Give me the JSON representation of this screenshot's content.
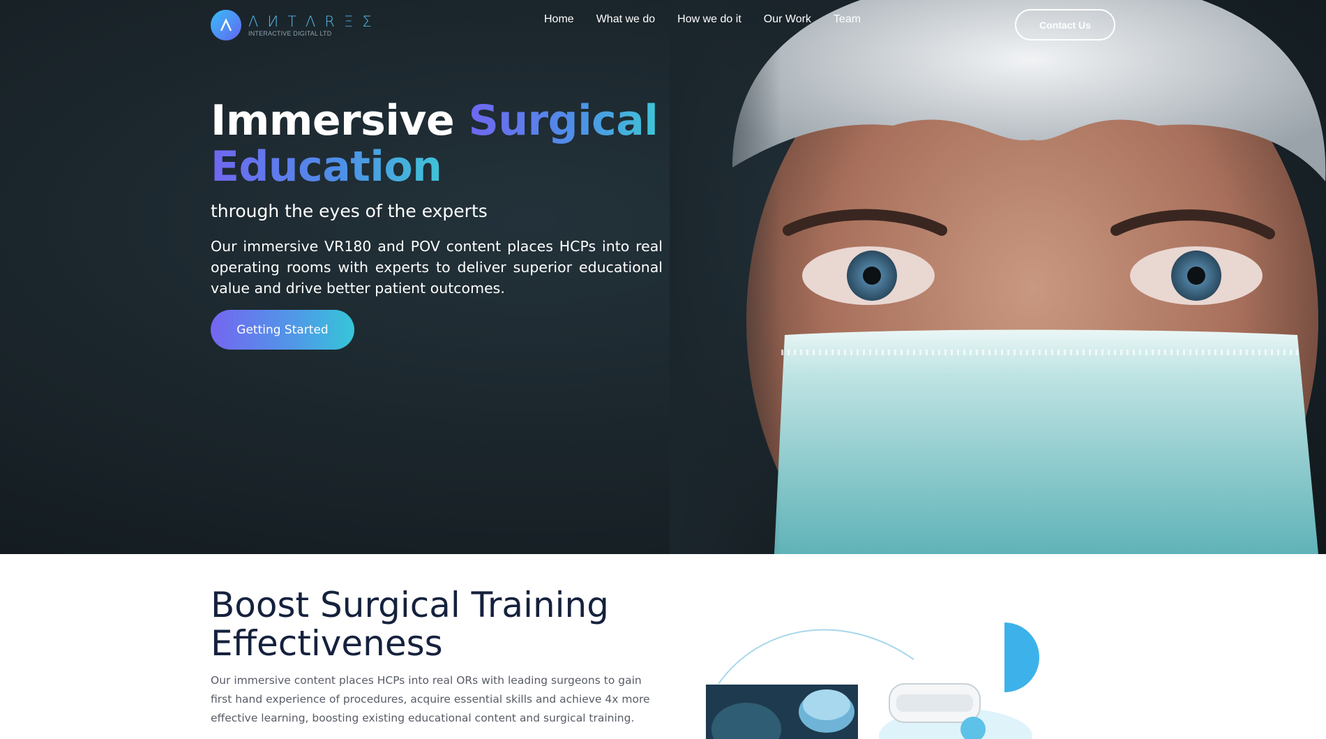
{
  "brand": {
    "name": "ΛИTΛRΞΣ",
    "subtitle": "INTERACTIVE DIGITAL LTD",
    "logo_icon": "antares-logo-icon",
    "accent": "#4f9ae7"
  },
  "nav": {
    "items": [
      "Home",
      "What we do",
      "How we do it",
      "Our Work",
      "Team"
    ],
    "contact_label": "Contact Us"
  },
  "hero": {
    "title_plain": "Immersive",
    "title_gradient_1": "Surgical",
    "title_gradient_2": "Education",
    "subtitle": "through the eyes of the experts",
    "description": "Our immersive VR180 and POV content places HCPs into real operating rooms with experts to deliver superior educational value and drive better patient outcomes.",
    "cta_label": "Getting Started",
    "image": "surgeon-portrait-photo"
  },
  "section2": {
    "title": "Boost Surgical Training Effectiveness",
    "description": "Our immersive content places HCPs into real ORs with leading surgeons to gain first hand experience of procedures, acquire essential skills and achieve 4x more effective learning, boosting existing educational content and surgical training.",
    "images": [
      "surgeons-operating-photo",
      "vr-headset-photo"
    ]
  }
}
